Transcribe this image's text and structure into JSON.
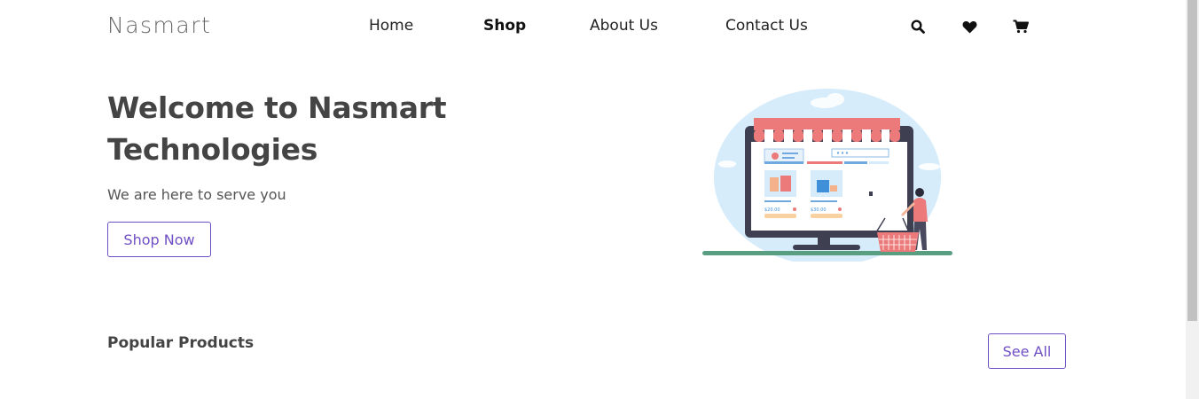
{
  "header": {
    "logo": "Nasmart",
    "nav": [
      "Home",
      "Shop",
      "About Us",
      "Contact Us"
    ],
    "active_nav": "Shop",
    "icons": [
      "search-icon",
      "heart-icon",
      "cart-icon"
    ]
  },
  "hero": {
    "title": "Welcome to Nasmart Technologies",
    "subtitle": "We are here to serve you",
    "cta": "Shop Now",
    "illustration_prices": [
      "$20.00",
      "$30.00"
    ]
  },
  "popular": {
    "title": "Popular Products",
    "see_all": "See All"
  },
  "colors": {
    "accent": "#6f4fc4",
    "awning": "#ec7a7a",
    "sky": "#d6ecfb",
    "ground": "#5a9e82"
  }
}
